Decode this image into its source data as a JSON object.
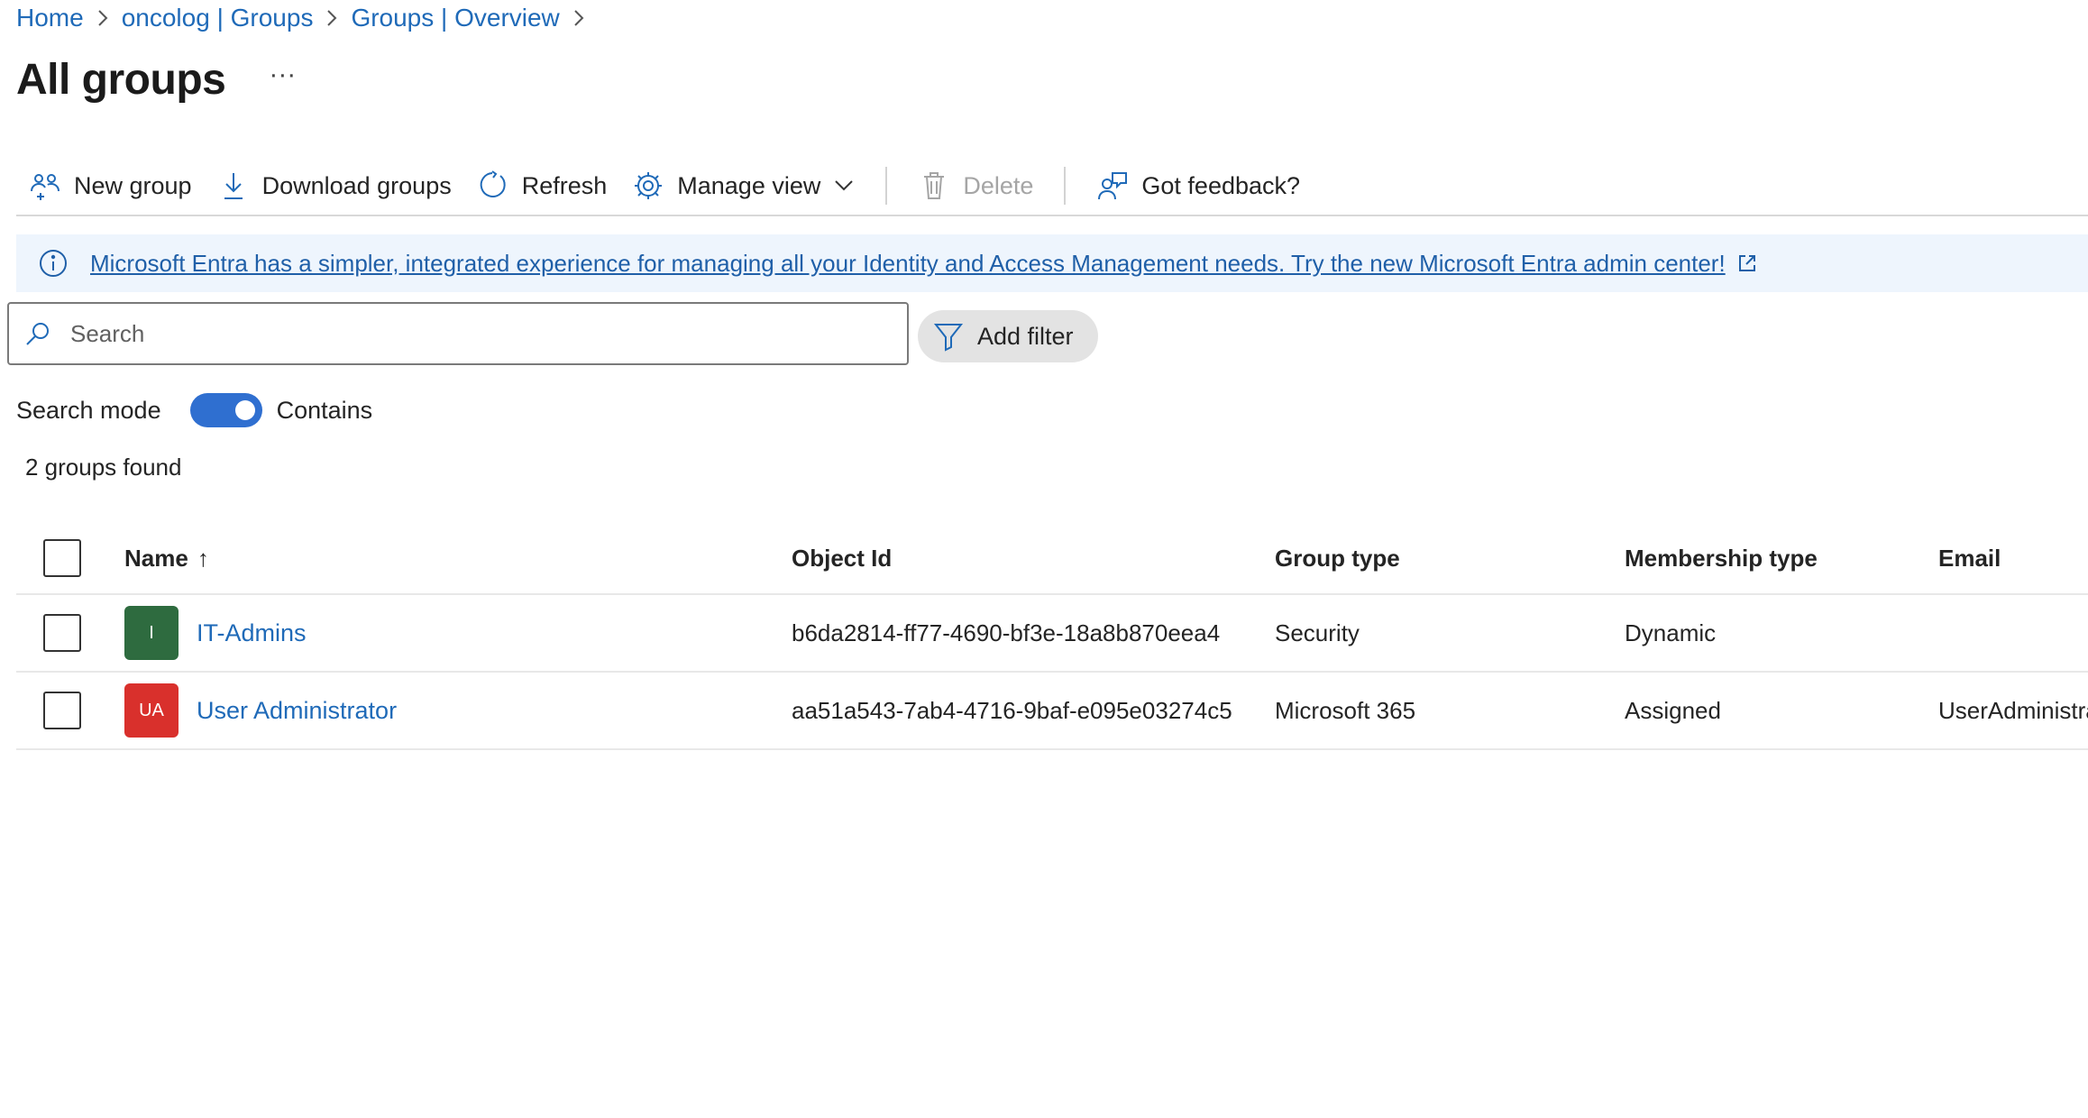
{
  "breadcrumb": {
    "items": [
      {
        "label": "Home"
      },
      {
        "label": "oncolog | Groups"
      },
      {
        "label": "Groups | Overview"
      }
    ]
  },
  "page": {
    "title": "All groups",
    "more_label": "···"
  },
  "toolbar": {
    "new_group": "New group",
    "download_groups": "Download groups",
    "refresh": "Refresh",
    "manage_view": "Manage view",
    "delete": "Delete",
    "feedback": "Got feedback?"
  },
  "banner": {
    "text": "Microsoft Entra has a simpler, integrated experience for managing all your Identity and Access Management needs. Try the new Microsoft Entra admin center!"
  },
  "search": {
    "placeholder": "Search",
    "value": "",
    "add_filter": "Add filter"
  },
  "search_mode": {
    "label": "Search mode",
    "toggle_on": true,
    "value_label": "Contains"
  },
  "results": {
    "count_text": "2 groups found"
  },
  "table": {
    "columns": {
      "name": "Name",
      "name_sort": "↑",
      "object_id": "Object Id",
      "group_type": "Group type",
      "membership_type": "Membership type",
      "email": "Email"
    },
    "rows": [
      {
        "initials": "I",
        "avatar_color": "#2e6b3f",
        "name": "IT-Admins",
        "object_id": "b6da2814-ff77-4690-bf3e-18a8b870eea4",
        "group_type": "Security",
        "membership_type": "Dynamic",
        "email": ""
      },
      {
        "initials": "UA",
        "avatar_color": "#d9302c",
        "name": "User Administrator",
        "object_id": "aa51a543-7ab4-4716-9baf-e095e03274c5",
        "group_type": "Microsoft 365",
        "membership_type": "Assigned",
        "email": "UserAdministra"
      }
    ]
  },
  "colors": {
    "accent": "#2f6fd0",
    "link": "#1f6ab8",
    "banner_bg": "#eef5fd"
  }
}
